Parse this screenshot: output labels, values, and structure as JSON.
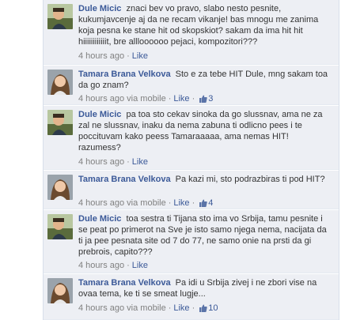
{
  "comments": [
    {
      "author": "Dule Micic",
      "avatar_icon": "profile-photo-dule",
      "text": "znaci bev vo pravo, slabo nesto pesnite, kukumjavcenje aj da ne recam vikanje! bas mnogu me zanima koja pesna ke stane hit od skopskiot? sakam da ima hit hit hiiiiiiiiiiiit, bre allloooooo pejaci, kompozitori???",
      "time": "4 hours ago",
      "via": "",
      "like_label": "Like",
      "like_count": ""
    },
    {
      "author": "Tamara Brana Velkova",
      "avatar_icon": "profile-photo-tamara",
      "text": "Sto e za tebe HIT Dule, mng sakam toa da go znam?",
      "time": "4 hours ago",
      "via": "via mobile",
      "like_label": "Like",
      "like_count": "3"
    },
    {
      "author": "Dule Micic",
      "avatar_icon": "profile-photo-dule",
      "text": "pa toa sto cekav sinoka da go slussnav, ama ne za zal ne slussnav, inaku da nema zabuna ti odlicno pees i te poccituvam kako peess Tamaraaaaa, ama nemas HIT! razumess?",
      "time": "4 hours ago",
      "via": "",
      "like_label": "Like",
      "like_count": ""
    },
    {
      "author": "Tamara Brana Velkova",
      "avatar_icon": "profile-photo-tamara",
      "text": "Pa kazi mi, sto podrazbiras ti pod HIT?",
      "time": "4 hours ago",
      "via": "via mobile",
      "like_label": "Like",
      "like_count": "4"
    },
    {
      "author": "Dule Micic",
      "avatar_icon": "profile-photo-dule",
      "text": "toa sestra ti Tijana sto ima vo Srbija, tamu pesnite i se peat po primerot na Sve je isto samo njega nema, nacijata da ti ja pee pesnata site od 7 do 77, ne samo onie na prsti da gi prebrois, capito???",
      "time": "4 hours ago",
      "via": "",
      "like_label": "Like",
      "like_count": ""
    },
    {
      "author": "Tamara Brana Velkova",
      "avatar_icon": "profile-photo-tamara",
      "text": "Pa idi u Srbija zivej i ne zbori vise na ovaa tema, ke ti se smeat lugje...",
      "time": "4 hours ago",
      "via": "via mobile",
      "like_label": "Like",
      "like_count": "10"
    }
  ],
  "icons": {
    "like_count_icon": "thumbs-up-icon"
  },
  "colors": {
    "comment_bg": "#edeff4",
    "link": "#3b5998",
    "meta": "#808080",
    "border": "#d8dfea"
  }
}
